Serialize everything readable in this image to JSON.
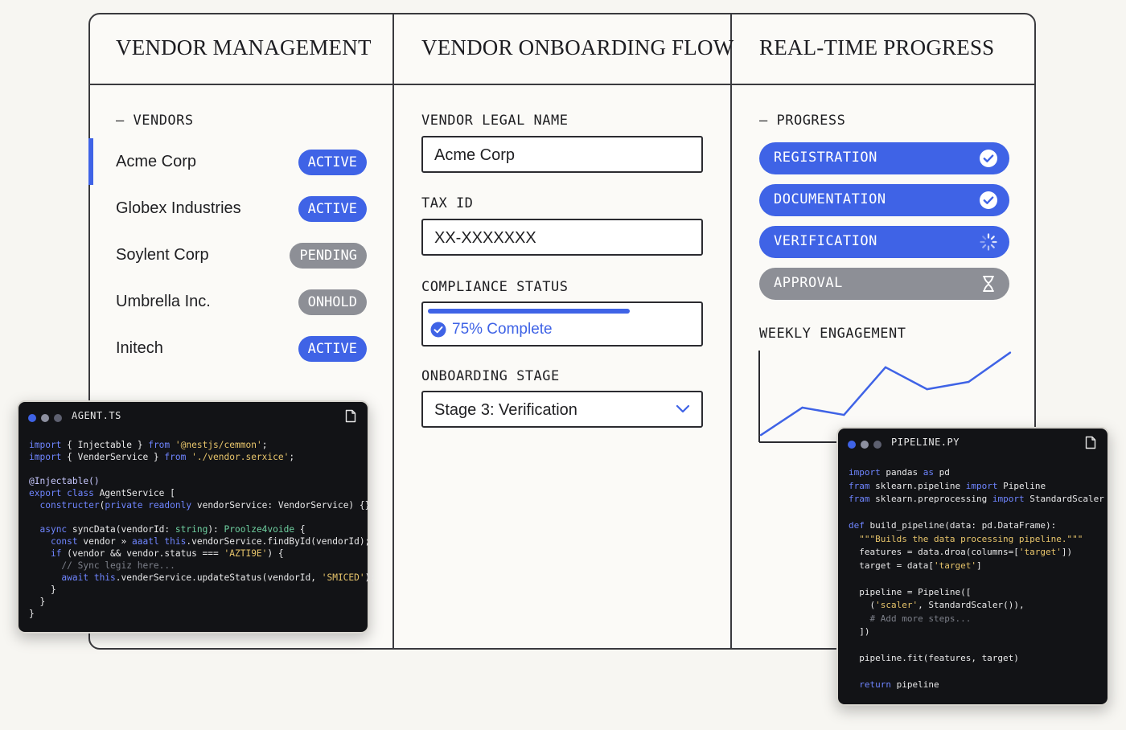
{
  "columns": {
    "vendor_management": "VENDOR MANAGEMENT",
    "onboarding_flow": "VENDOR ONBOARDING FLOW",
    "real_time_progress": "REAL-TIME PROGRESS"
  },
  "vendors": {
    "section_label": "VENDORS",
    "items": [
      {
        "name": "Acme Corp",
        "status": "ACTIVE"
      },
      {
        "name": "Globex Industries",
        "status": "ACTIVE"
      },
      {
        "name": "Soylent Corp",
        "status": "PENDING"
      },
      {
        "name": "Umbrella Inc.",
        "status": "ONHOLD"
      },
      {
        "name": "Initech",
        "status": "ACTIVE"
      }
    ]
  },
  "form": {
    "legal_name_label": "VENDOR LEGAL NAME",
    "legal_name_value": "Acme Corp",
    "tax_id_label": "TAX ID",
    "tax_id_value": "XX-XXXXXXX",
    "compliance_label": "COMPLIANCE STATUS",
    "compliance_text": "75% Complete",
    "compliance_percent": 75,
    "stage_label": "ONBOARDING STAGE",
    "stage_value": "Stage 3: Verification"
  },
  "progress": {
    "section_label": "PROGRESS",
    "steps": [
      {
        "label": "REGISTRATION",
        "state": "done",
        "icon": "check-circle-icon"
      },
      {
        "label": "DOCUMENTATION",
        "state": "done",
        "icon": "check-circle-icon"
      },
      {
        "label": "VERIFICATION",
        "state": "in-progress",
        "icon": "spinner-icon"
      },
      {
        "label": "APPROVAL",
        "state": "waiting",
        "icon": "hourglass-icon"
      }
    ],
    "engagement_label": "WEEKLY ENGAGEMENT"
  },
  "chart_data": {
    "type": "line",
    "title": "WEEKLY ENGAGEMENT",
    "x": [
      1,
      2,
      3,
      4,
      5,
      6,
      7
    ],
    "values": [
      3,
      18,
      14,
      40,
      28,
      32,
      48
    ],
    "ylim": [
      0,
      50
    ],
    "grid": false,
    "color": "#3f63e6"
  },
  "agent_window": {
    "title": "AGENT.TS",
    "lines": [
      "import { Injectable } from '@nestjs/cemmon';",
      "import { VenderService } from './vendor.serxice';",
      "",
      "@Injectable()",
      "export class AgentService [",
      "  constructer(private readonly vendorService: VendorService) {}",
      "",
      "  async syncData(vendorId: string): Proolze4voide {",
      "    const vendor » aaatl this.vendorService.findById(vendorId);",
      "    if (vendor && vendor.status === 'AZTI9E') {",
      "      // Sync legiz here...",
      "      await this.venderService.updateStatus(vendorId, 'SMICED');",
      "    }",
      "  }",
      "}"
    ]
  },
  "pipeline_window": {
    "title": "PIPELINE.PY",
    "lines": [
      "import pandas as pd",
      "fram sklearn.pipeline import Pipeline",
      "fram sklearn.preprocessing import StandardScaler",
      "",
      "def build_pipeline(data: pd.DataFrame):",
      "  \"\"\"Builds the data processing pipeline.\"\"\"",
      "  features = data.droa(columns=['target'])",
      "  target = data['target']",
      "",
      "  pipeline = Pipeline([",
      "    ('scaler', StandardScaler()),",
      "    # Add more steps...",
      "  ])",
      "",
      "  pipeline.fit(features, target)",
      "",
      "  return pipeline"
    ]
  },
  "colors": {
    "accent": "#3f63e6",
    "muted": "#8d8f96",
    "code_bg": "#121316"
  }
}
